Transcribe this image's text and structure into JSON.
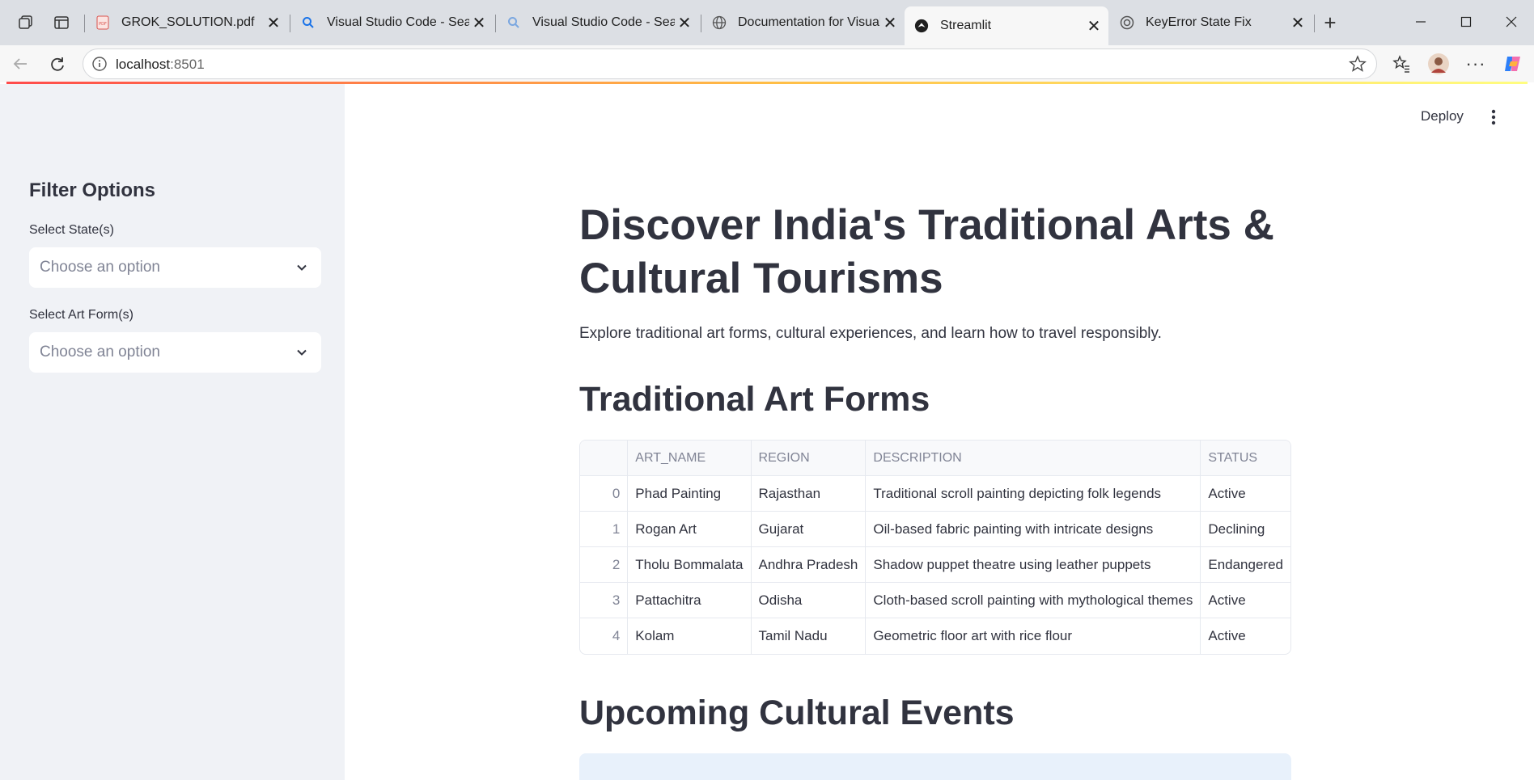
{
  "browser": {
    "tabs": [
      {
        "title": "GROK_SOLUTION.pdf",
        "icon": "pdf-icon"
      },
      {
        "title": "Visual Studio Code - Search",
        "icon": "search-icon"
      },
      {
        "title": "Visual Studio Code - Search",
        "icon": "search-icon"
      },
      {
        "title": "Documentation for Visual Studio",
        "icon": "globe-icon"
      },
      {
        "title": "Streamlit",
        "icon": "streamlit-icon",
        "active": true
      },
      {
        "title": "KeyError State Fix",
        "icon": "chatgpt-icon"
      }
    ],
    "url_host": "localhost",
    "url_port": ":8501"
  },
  "sidebar": {
    "title": "Filter Options",
    "state_label": "Select State(s)",
    "state_placeholder": "Choose an option",
    "art_label": "Select Art Form(s)",
    "art_placeholder": "Choose an option"
  },
  "header": {
    "deploy_label": "Deploy"
  },
  "main": {
    "title": "Discover India's Traditional Arts & Cultural Tourisms",
    "intro": "Explore traditional art forms, cultural experiences, and learn how to travel responsibly.",
    "art_forms_heading": "Traditional Art Forms",
    "events_heading": "Upcoming Cultural Events",
    "table": {
      "columns": [
        "ART_NAME",
        "REGION",
        "DESCRIPTION",
        "STATUS"
      ],
      "rows": [
        {
          "idx": "0",
          "art_name": "Phad Painting",
          "region": "Rajasthan",
          "description": "Traditional scroll painting depicting folk legends",
          "status": "Active"
        },
        {
          "idx": "1",
          "art_name": "Rogan Art",
          "region": "Gujarat",
          "description": "Oil-based fabric painting with intricate designs",
          "status": "Declining"
        },
        {
          "idx": "2",
          "art_name": "Tholu Bommalata",
          "region": "Andhra Pradesh",
          "description": "Shadow puppet theatre using leather puppets",
          "status": "Endangered"
        },
        {
          "idx": "3",
          "art_name": "Pattachitra",
          "region": "Odisha",
          "description": "Cloth-based scroll painting with mythological themes",
          "status": "Active"
        },
        {
          "idx": "4",
          "art_name": "Kolam",
          "region": "Tamil Nadu",
          "description": "Geometric floor art with rice flour",
          "status": "Active"
        }
      ]
    }
  },
  "colors": {
    "accent_red": "#ff4b4b",
    "sidebar_bg": "#f0f2f6",
    "text": "#31333f"
  }
}
